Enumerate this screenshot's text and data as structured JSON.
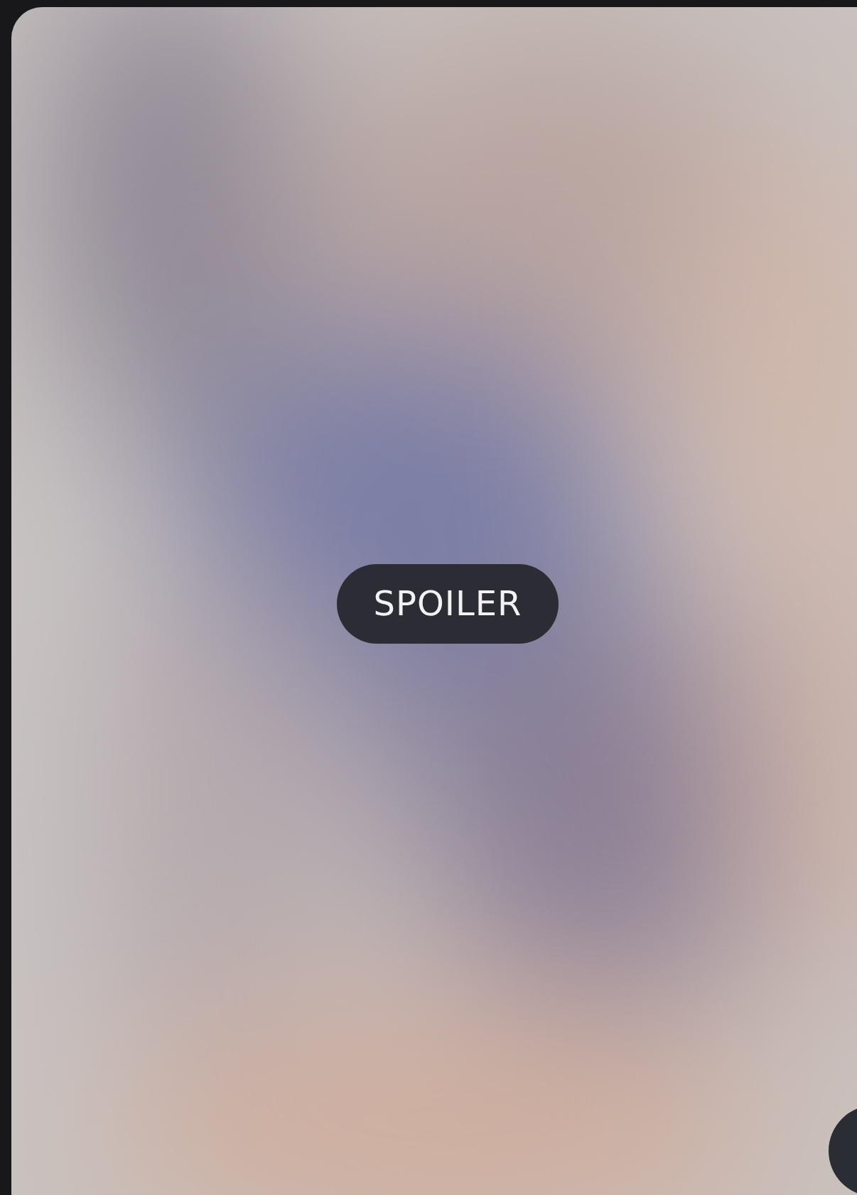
{
  "media": {
    "kind": "picture",
    "spoiler_label": "SPOILER"
  }
}
